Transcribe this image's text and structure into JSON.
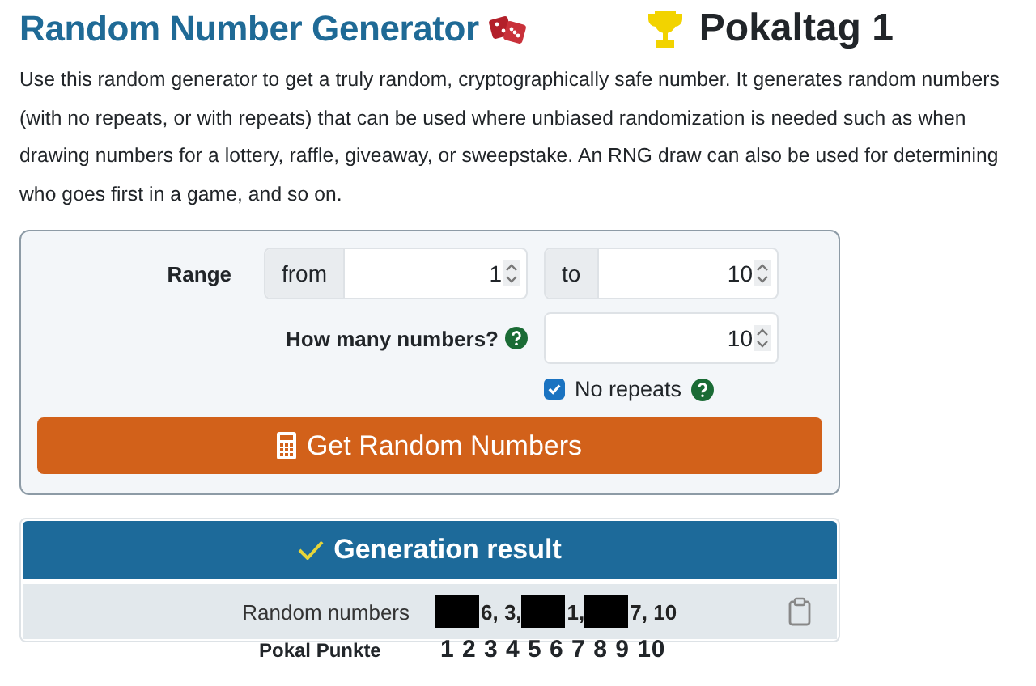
{
  "header": {
    "title": "Random Number Generator",
    "badge": "Pokaltag 1"
  },
  "intro": "Use this random generator to get a truly random, cryptographically safe number. It generates random numbers (with no repeats, or with repeats) that can be used where unbiased randomization is needed such as when drawing numbers for a lottery, raffle, giveaway, or sweepstake. An RNG draw can also be used for determining who goes first in a game, and so on.",
  "form": {
    "range_label": "Range",
    "from_label": "from",
    "from_value": "1",
    "to_label": "to",
    "to_value": "10",
    "count_label": "How many numbers?",
    "count_value": "10",
    "no_repeats": {
      "label": "No repeats",
      "checked": true
    },
    "button": "Get Random Numbers"
  },
  "result": {
    "title": "Generation result",
    "label": "Random numbers",
    "parts": [
      {
        "kind": "redacted"
      },
      {
        "kind": "text",
        "text": "6, 3,"
      },
      {
        "kind": "redacted"
      },
      {
        "kind": "text",
        "text": "1,"
      },
      {
        "kind": "redacted"
      },
      {
        "kind": "text",
        "text": "7, 10"
      }
    ]
  },
  "points": {
    "label": "Pokal Punkte",
    "values": "1 2 3 4 5 6 7 8 9 10"
  }
}
